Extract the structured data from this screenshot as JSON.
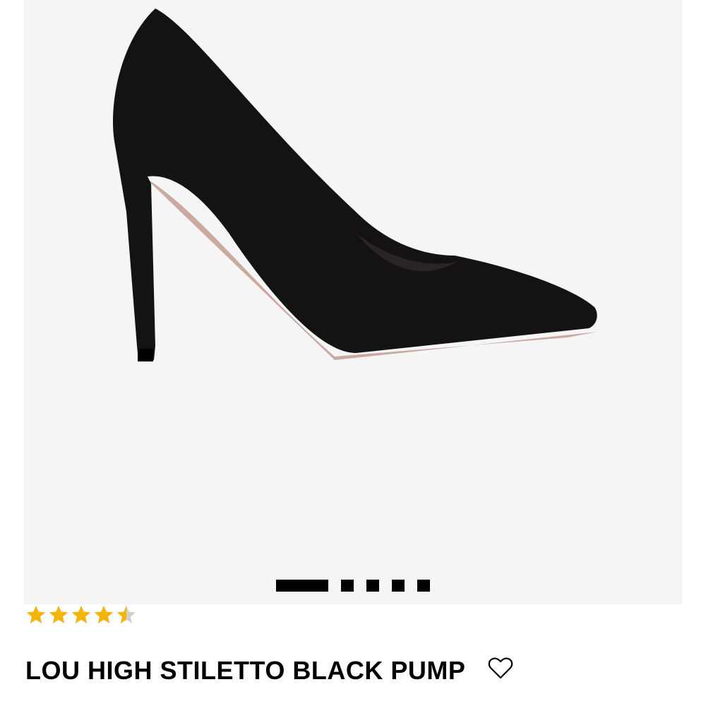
{
  "product": {
    "title": "LOU HIGH STILETTO BLACK PUMP",
    "image_alt": "Lou high stiletto black suede pump",
    "colors": {
      "gallery_bg": "#f5f5f5",
      "shoe": "#141212",
      "sole": "#caa9a2",
      "star": "#f5b400",
      "star_empty": "#cfcfcf"
    }
  },
  "gallery": {
    "slide_count": 5,
    "active_slide": 1
  },
  "rating": {
    "value": 4.5,
    "max": 5,
    "icon": "star-icon"
  },
  "actions": {
    "wishlist_icon": "heart-outline-icon"
  }
}
